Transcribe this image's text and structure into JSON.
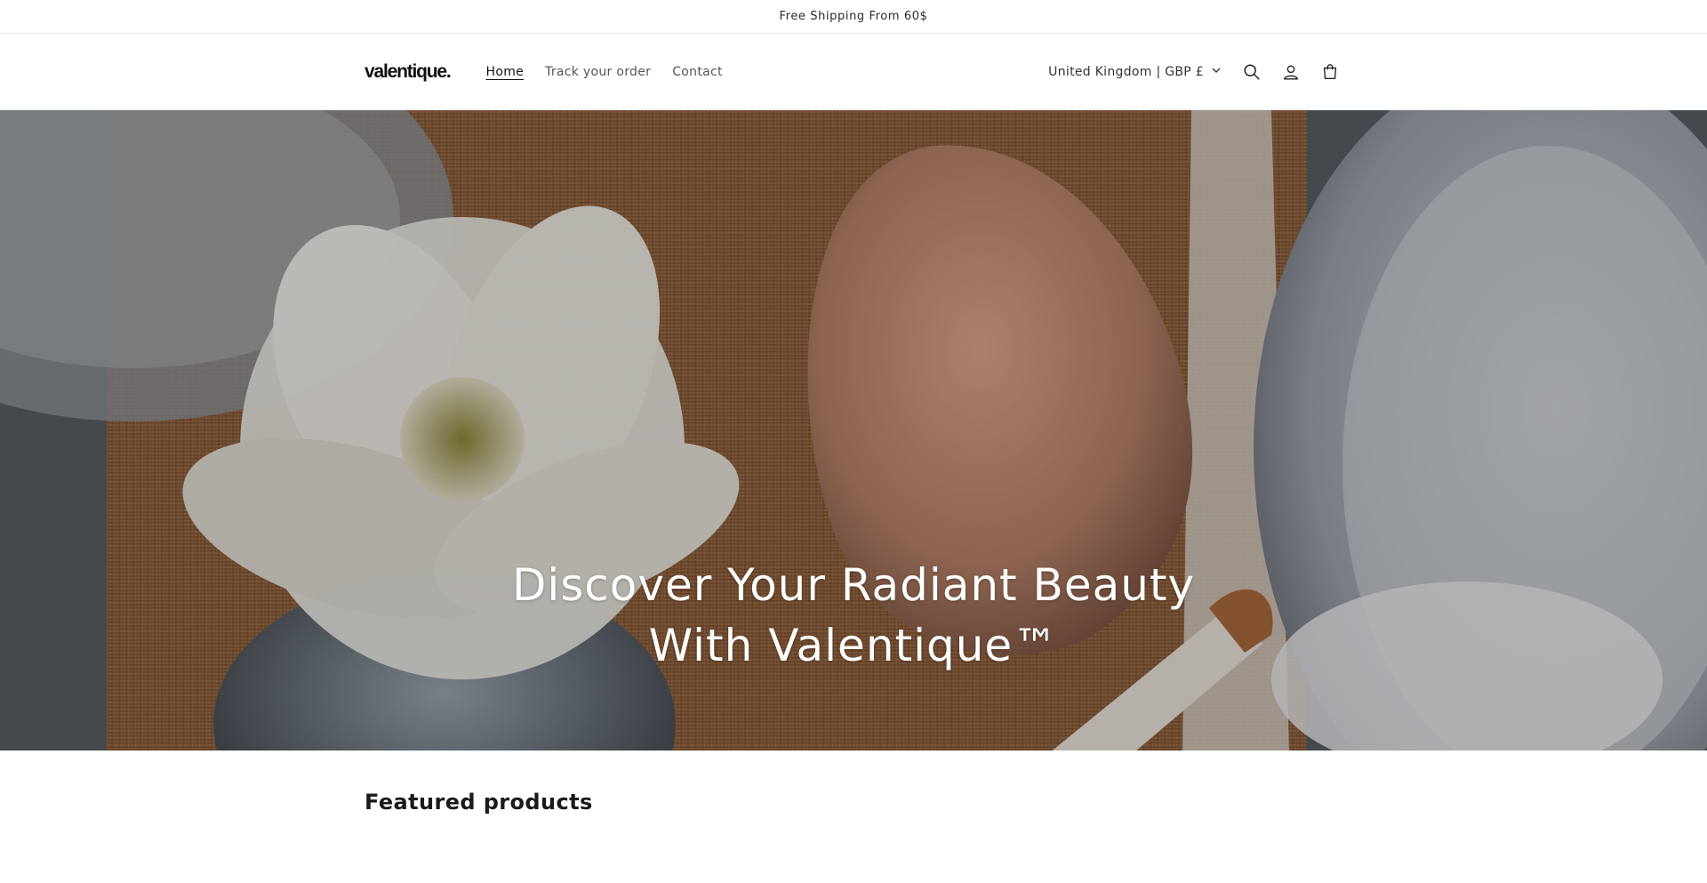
{
  "announcement": {
    "text": "Free Shipping From 60$"
  },
  "header": {
    "logo": "valentique.",
    "nav": [
      {
        "label": "Home",
        "active": true
      },
      {
        "label": "Track your order",
        "active": false
      },
      {
        "label": "Contact",
        "active": false
      }
    ],
    "country_selector": "United Kingdom | GBP £",
    "icons": [
      "search-icon",
      "account-icon",
      "cart-icon"
    ]
  },
  "hero": {
    "heading": "Discover Your Radiant Beauty With Valentique™"
  },
  "sections": {
    "featured_title": "Featured products"
  },
  "colors": {
    "text": "#121212",
    "hero_overlay": "rgba(0,0,0,0.22)"
  }
}
